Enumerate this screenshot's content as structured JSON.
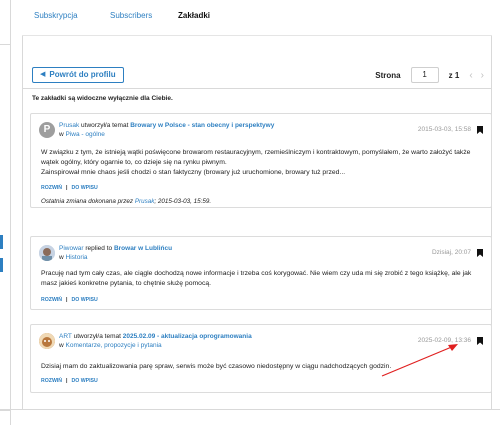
{
  "tabs": [
    {
      "label": "Subskrypcja"
    },
    {
      "label": "Subscribers"
    },
    {
      "label": "Zakładki"
    }
  ],
  "toolbar": {
    "back_label": "Powrót do profilu",
    "page_label": "Strona",
    "page_value": "1",
    "page_of": "z 1"
  },
  "notice": "Te zakładki są widoczne wyłącznie dla Ciebie.",
  "posts": [
    {
      "user": "Prusak",
      "verb": "utworzył/a temat",
      "title": "Browary w Polsce - stan obecny i perspektywy",
      "in": "w",
      "forum": "Piwa - ogólne",
      "date": "2015-03-03, 15:58",
      "body1": "W związku z tym, że istnieją wątki poświęcone browarom restauracyjnym, rzemieślniczym i kontraktowym, pomyślałem, że warto założyć także wątek ogólny, który ogarnie nas w tym co dzieje się na rynku piwnym.",
      "body1_short": "W związku z tym, że istnieją wątki poświęcone browarom restauracyjnym, rzemieślniczym i kontraktowym, pomyślałem, że warto założyć także wątek ogólny, który ogarnie to, co dzieje się na rynku piwnym.",
      "body2": "Zainspirował mnie chaos jeśli chodzi o stan faktyczny (browary już uruchomione, browary tuż przed...",
      "expand": "ROZWIŃ",
      "goto": "DO WPISU",
      "edit_prefix": "Ostatnia zmiana dokonana przez",
      "edit_user": "Prusak",
      "edit_date": "; 2015-03-03, 15:59."
    },
    {
      "user": "Piwowar",
      "verb": "replied to",
      "title": "Browar w Lublińcu",
      "in": "w",
      "forum": "Historia",
      "date": "Dzisiaj, 20:07",
      "body1": "Pracuję nad tym cały czas, ale ciągle dochodzą nowe informacje i trzeba coś korygować. Nie wiem czy uda mi się zrobić z tego książkę, ale jak masz jakieś konkretne pytania, to chętnie służę pomocą.",
      "expand": "ROZWIŃ",
      "goto": "DO WPISU"
    },
    {
      "user": "ART",
      "verb": "utworzył/a temat",
      "title": "2025.02.09 - aktualizacja oprogramowania",
      "in": "w",
      "forum": "Komentarze, propozycje i pytania",
      "date": "2025-02-09, 13:36",
      "body1": "Dzisiaj mam do zaktualizowania parę spraw, serwis może być czasowo niedostępny w ciągu nadchodzących godzin.",
      "expand": "ROZWIŃ",
      "goto": "DO WPISU"
    }
  ],
  "colors": {
    "accent": "#2d7fc1",
    "arrow": "#e02020"
  }
}
